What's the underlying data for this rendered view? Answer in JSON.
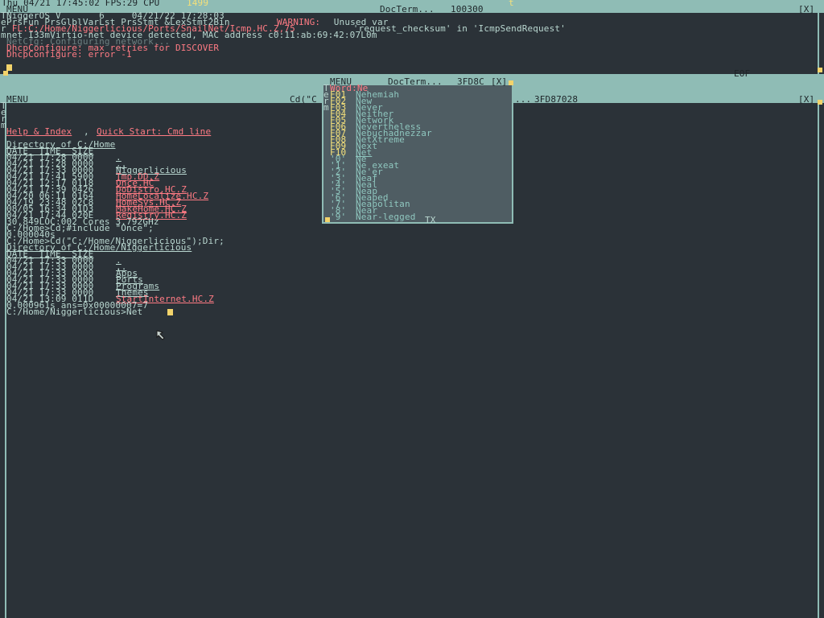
{
  "sysbar": {
    "clock_fps": "Thu 04/21 17:45:02 FPS:29 CPU",
    "cpu_value": "1499",
    "tick_marker": "t"
  },
  "top_window": {
    "menu_label": "MENU",
    "title": "DocTerm...",
    "task_id": "100300",
    "close": "[X]",
    "side_letters": [
      "T",
      "e",
      "r",
      "m"
    ],
    "lines": [
      {
        "text": "NiggerOS V       6     04/21/22 17:28:03",
        "color": "light"
      },
      {
        "text": "PrsFun PrsGlblVarLst PrsStmt &LexStmt2Bin ",
        "color": "light",
        "suffix": "WARNING:",
        "suffix_color": "red",
        "suffix2": " Unused var",
        "suffix2_color": "light"
      },
      {
        "text": " FL:C:/Home/Niggerlicious/Ports/SnailNet/Icmp.HC.Z,75",
        "color": "red",
        "suffix": " 'request_checksum' in 'IcmpSendRequest'",
        "suffix_color": "light"
      },
      {
        "text": "net I33mVirtio-net device detected, MAC address c0:11:ab:69:42:07L0m",
        "color": "light"
      },
      {
        "text": "NetCfg: Configuring network...",
        "color": "dim"
      },
      {
        "text": "DhcpConfigure: max retries for DISCOVER",
        "color": "red"
      },
      {
        "text": "DhcpConfigure: error -1",
        "color": "red"
      }
    ],
    "eof": "EOF"
  },
  "main_window": {
    "menu_label": "MENU",
    "title": "Cd(\"C",
    "task_id": "3FD87028",
    "close": "[X]",
    "side_letters": [
      "T",
      "e",
      "r",
      "m"
    ],
    "help_link": "Help & Index",
    "quick_link": "Quick Start: Cmd line",
    "dir1_header": "Directory of C:/Home",
    "dir_cols": "DATE_ TIME_ SIZE",
    "dir1_rows": [
      {
        "meta": "04/21 17:28 0000",
        "name": ".",
        "color": "light"
      },
      {
        "meta": "04/21 17:28 0000",
        "name": "..",
        "color": "light"
      },
      {
        "meta": "04/21 17:33 0000",
        "name": "Niggerlicious",
        "color": "light"
      },
      {
        "meta": "04/21 17:41 5900",
        "name": "Tmp.DD.Z",
        "color": "red"
      },
      {
        "meta": "04/21 12:17 0118",
        "name": "Once.HC",
        "color": "red"
      },
      {
        "meta": "04/21 17:39 0426",
        "name": "DoDistro.HC.Z",
        "color": "red"
      },
      {
        "meta": "04/20 06:11 0164",
        "name": "HomeLocalize.HC.Z",
        "color": "red"
      },
      {
        "meta": "04/19 23:48 02C8",
        "name": "HomeSys.HC.Z",
        "color": "red"
      },
      {
        "meta": "08/05 16:34 01D3",
        "name": "MakeHome.HC.Z",
        "color": "red"
      },
      {
        "meta": "04/21 17:44 020E",
        "name": "Registry.HC.Z",
        "color": "red"
      }
    ],
    "loc_line": "30,849LOC:002 Cores 3.792GHz",
    "cmd1": "C:/Home>Cd;#include \"Once\";",
    "time1": "0.000040s",
    "cmd2": "C:/Home>Cd(\"C:/Home/Niggerlicious\");Dir;",
    "dir2_header": "Directory of C:/Home/Niggerlicious",
    "dir2_rows": [
      {
        "meta": "04/21 17:33 0000",
        "name": ".",
        "color": "light"
      },
      {
        "meta": "04/21 17:33 0000",
        "name": "..",
        "color": "light"
      },
      {
        "meta": "04/21 17:33 0000",
        "name": "Apps",
        "color": "light"
      },
      {
        "meta": "04/21 17:33 0000",
        "name": "Ports",
        "color": "light"
      },
      {
        "meta": "04/21 17:33 0000",
        "name": "Programs",
        "color": "light"
      },
      {
        "meta": "04/21 17:33 0000",
        "name": "Themes",
        "color": "light"
      },
      {
        "meta": "04/21 13:09 011D",
        "name": "StartInternet.HC.Z",
        "color": "red"
      }
    ],
    "time2": "0.000961s ans=0x00000007=7",
    "prompt": "C:/Home/Niggerlicious>Net"
  },
  "autocomplete": {
    "menu_label": "MENU",
    "title": "DocTerm...",
    "task_id": "3FD8C",
    "close": "[X]",
    "side_letters": [
      "T",
      "e",
      "r",
      "m"
    ],
    "word": "Word:Ne",
    "fkeys": [
      {
        "key": "F01",
        "word": "Nehemiah"
      },
      {
        "key": "F02",
        "word": "New"
      },
      {
        "key": "F03",
        "word": "Never"
      },
      {
        "key": "F04",
        "word": "Neither"
      },
      {
        "key": "F05",
        "word": "Network"
      },
      {
        "key": "F06",
        "word": "Nevertheless"
      },
      {
        "key": "F07",
        "word": "Nebuchadnezzar"
      },
      {
        "key": "F08",
        "word": "NetXtreme"
      },
      {
        "key": "F09",
        "word": "Next"
      },
      {
        "key": "F10",
        "word": "Net"
      }
    ],
    "nums": [
      {
        "key": "'0'",
        "word": "Ne"
      },
      {
        "key": "'1'",
        "word": "Ne exeat"
      },
      {
        "key": "'2'",
        "word": "Ne'er"
      },
      {
        "key": "'3'",
        "word": "Neaf"
      },
      {
        "key": "'4'",
        "word": "Neal"
      },
      {
        "key": "'5'",
        "word": "Neap"
      },
      {
        "key": "'6'",
        "word": "Neaped"
      },
      {
        "key": "'7'",
        "word": "Neapolitan"
      },
      {
        "key": "'8'",
        "word": "Near"
      },
      {
        "key": "'9'",
        "word": "Near-legged"
      }
    ],
    "footer": "TX",
    "extra_title": "..."
  },
  "colors": {
    "background": "#2b3238",
    "border": "#8fbcb5",
    "text": "#b9d7d0",
    "link": "#ff7b84",
    "highlight": "#f4e07a"
  }
}
